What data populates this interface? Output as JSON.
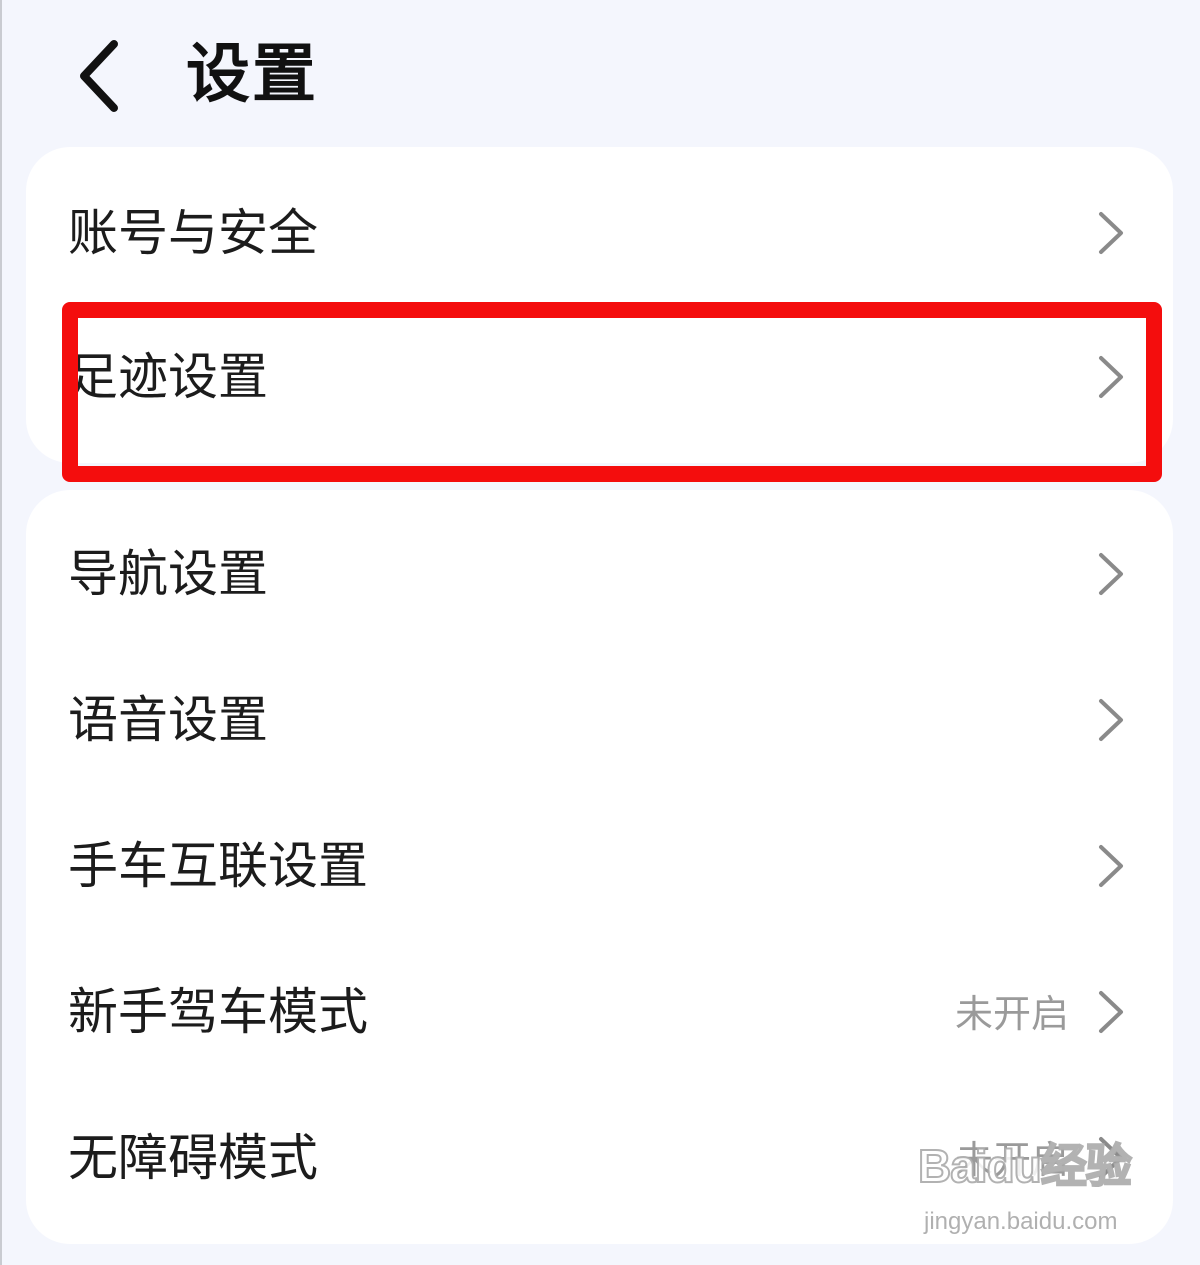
{
  "header": {
    "title": "设置",
    "back_icon": "chevron-left-icon"
  },
  "groups": [
    {
      "items": [
        {
          "label": "账号与安全",
          "value": "",
          "icon": "chevron-right-icon"
        },
        {
          "label": "足迹设置",
          "value": "",
          "icon": "chevron-right-icon",
          "highlighted": true
        }
      ]
    },
    {
      "items": [
        {
          "label": "导航设置",
          "value": "",
          "icon": "chevron-right-icon"
        },
        {
          "label": "语音设置",
          "value": "",
          "icon": "chevron-right-icon"
        },
        {
          "label": "手车互联设置",
          "value": "",
          "icon": "chevron-right-icon"
        },
        {
          "label": "新手驾车模式",
          "value": "未开启",
          "icon": "chevron-right-icon"
        },
        {
          "label": "无障碍模式",
          "value": "未开启",
          "icon": "chevron-right-icon"
        }
      ]
    }
  ],
  "watermark": {
    "logo_text": "Baidu经验",
    "url": "jingyan.baidu.com"
  },
  "colors": {
    "background": "#f4f6fd",
    "card": "#ffffff",
    "highlight": "#f40d0d",
    "secondary_text": "#9a9a9a"
  }
}
